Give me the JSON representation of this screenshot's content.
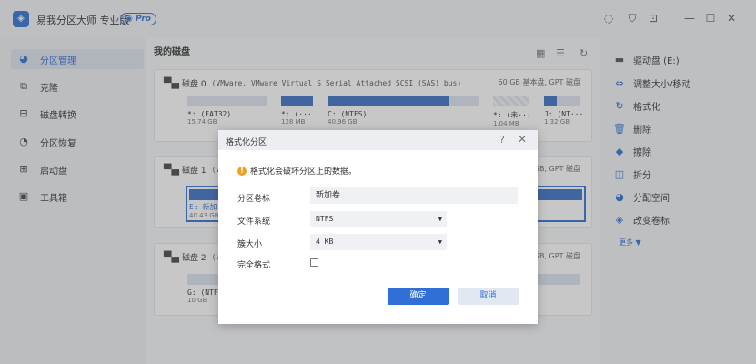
{
  "app": {
    "title": "易我分区大师 专业版",
    "badge": "Pro",
    "logo_icon": "app-logo-icon"
  },
  "window_controls": [
    "lightbulb-icon",
    "shield-icon",
    "export-icon",
    "minimize-icon",
    "maximize-icon",
    "close-icon"
  ],
  "sidebar": {
    "items": [
      {
        "label": "分区管理",
        "icon": "pie-icon",
        "active": true
      },
      {
        "label": "克隆",
        "icon": "clone-icon",
        "active": false
      },
      {
        "label": "磁盘转换",
        "icon": "disk-convert-icon",
        "active": false
      },
      {
        "label": "分区恢复",
        "icon": "recover-icon",
        "active": false
      },
      {
        "label": "启动盘",
        "icon": "boot-disk-icon",
        "active": false
      },
      {
        "label": "工具箱",
        "icon": "toolbox-icon",
        "active": false
      }
    ]
  },
  "main": {
    "title": "我的磁盘",
    "disks": [
      {
        "name": "磁盘 0",
        "desc": "(VMware,  VMware Virtual S Serial Attached SCSI (SAS) bus)",
        "cap": "60 GB 基本盘, GPT 磁盘",
        "partitions": [
          {
            "name": "*: (FAT32)",
            "size": "15.74 GB",
            "fill": 0.0
          },
          {
            "name": "*: (···",
            "size": "128 MB",
            "fill": 1.0
          },
          {
            "name": "C: (NTFS)",
            "size": "40.96 GB",
            "fill": 0.8
          },
          {
            "name": "*: (未···",
            "size": "1.04 MB",
            "fill": 0.0
          },
          {
            "name": "J: (NT···",
            "size": "1.32 GB",
            "fill": 0.35
          }
        ]
      },
      {
        "name": "磁盘 1",
        "desc": "(V",
        "cap": "GB, GPT 磁盘",
        "partitions": [
          {
            "name": "E: 新加",
            "size": "40.43 GB",
            "fill": 0.0
          }
        ]
      },
      {
        "name": "磁盘 2",
        "desc": "(V",
        "cap": "GB, GPT 磁盘",
        "partitions": [
          {
            "name": "G: (NTF",
            "size": "10 GB",
            "fill": 0.0
          }
        ]
      }
    ]
  },
  "rpanel": {
    "items": [
      {
        "label": "驱动盘  (E:)",
        "icon": "drive-icon"
      },
      {
        "label": "调整大小/移动",
        "icon": "resize-icon"
      },
      {
        "label": "格式化",
        "icon": "format-icon"
      },
      {
        "label": "删除",
        "icon": "trash-icon"
      },
      {
        "label": "擦除",
        "icon": "eraser-icon"
      },
      {
        "label": "拆分",
        "icon": "split-icon"
      },
      {
        "label": "分配空间",
        "icon": "allocate-icon"
      },
      {
        "label": "改变卷标",
        "icon": "tag-icon"
      }
    ],
    "more": "更多 ▼"
  },
  "dialog": {
    "title": "格式化分区",
    "warning": "格式化会破坏分区上的数据。",
    "label_volume": "分区卷标",
    "volume_value": "新加卷",
    "label_fs": "文件系统",
    "fs_value": "NTFS",
    "label_cluster": "簇大小",
    "cluster_value": "4 KB",
    "label_full": "完全格式",
    "full_checked": false,
    "ok": "确定",
    "cancel": "取消"
  }
}
